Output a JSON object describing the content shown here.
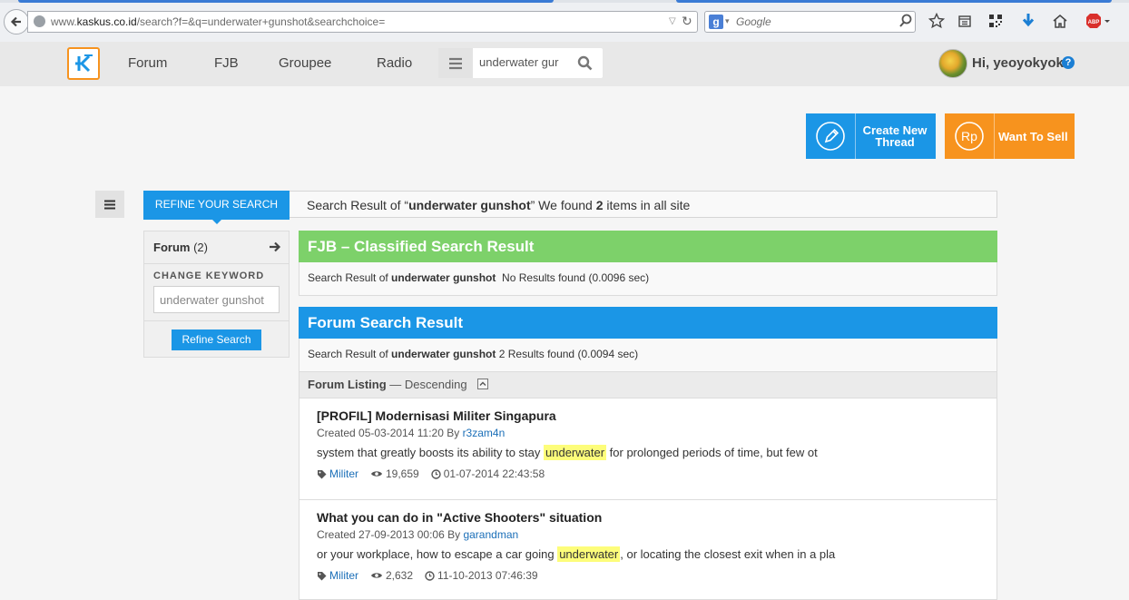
{
  "browser": {
    "url_prefix": "www.",
    "url_domain": "kaskus.co.id",
    "url_path": "/search?f=&q=underwater+gunshot&searchchoice=",
    "search_engine_letter": "g",
    "search_placeholder": "Google",
    "adblock_label": "ABP"
  },
  "site": {
    "nav": [
      "Forum",
      "FJB",
      "Groupee",
      "Radio"
    ],
    "search_value": "underwater gur",
    "greeting": "Hi, yeoyokyok",
    "help_label": "?"
  },
  "actions": {
    "create_label_line1": "Create New",
    "create_label_line2": "Thread",
    "sell_icon_text": "Rp",
    "sell_label": "Want To Sell"
  },
  "refine": {
    "tab_label": "REFINE YOUR SEARCH",
    "summary_prefix": "Search Result of “",
    "query": "underwater gunshot",
    "summary_mid": "” We found ",
    "count": "2",
    "summary_suffix": " items in all site"
  },
  "left_panel": {
    "forum_label": "Forum",
    "forum_count": "(2)",
    "change_keyword": "CHANGE KEYWORD",
    "keyword_value": "underwater gunshot",
    "refine_button": "Refine Search"
  },
  "fjb": {
    "heading": "FJB – Classified Search Result",
    "result_prefix": "Search Result of ",
    "query": "underwater gunshot",
    "result_suffix": "  No Results found (0.0096 sec)"
  },
  "forum": {
    "heading": "Forum Search Result",
    "result_prefix": "Search Result of ",
    "query": "underwater gunshot",
    "result_suffix": " 2 Results found (0.0094 sec)",
    "listing_label": "Forum Listing",
    "listing_order": " — Descending",
    "results": [
      {
        "title": "[PROFIL] Modernisasi Militer Singapura",
        "created": "Created 05-03-2014 11:20 By ",
        "author": "r3zam4n",
        "snippet_before": "system that greatly boosts its ability to stay ",
        "highlight": "underwater",
        "snippet_after": " for prolonged periods of time, but few ot",
        "category": "Militer",
        "views": "19,659",
        "last_post": "01-07-2014 22:43:58"
      },
      {
        "title": "What you can do in \"Active Shooters\" situation",
        "created": "Created 27-09-2013 00:06 By ",
        "author": "garandman",
        "snippet_before": "or your workplace, how to escape a car going ",
        "highlight": "underwater",
        "snippet_after": ", or locating the closest exit when in a pla",
        "category": "Militer",
        "views": "2,632",
        "last_post": "11-10-2013 07:46:39"
      }
    ]
  },
  "colors": {
    "kaskus_blue": "#1b96e6",
    "kaskus_orange": "#f7931e",
    "fjb_green": "#7dd16a",
    "highlight_yellow": "#fdfd7a"
  }
}
